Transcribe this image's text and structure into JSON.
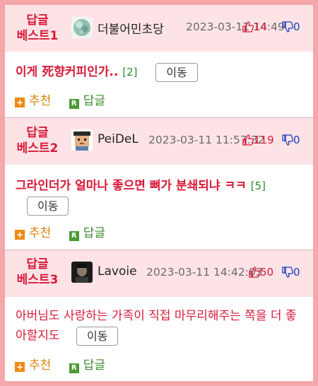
{
  "replies": [
    {
      "rank_top": "답글",
      "rank_bottom": "베스트1",
      "avatar": "green-crystal-icon",
      "nick": "더불어민초당",
      "date": "2023-03-11 14:49",
      "up": "14",
      "down": "0",
      "title": "이게 死향커피인가..",
      "count": "[2]",
      "move": "이동",
      "recommend": "추천",
      "reply": "답글"
    },
    {
      "rank_top": "답글",
      "rank_bottom": "베스트2",
      "avatar": "pixel-face-icon",
      "nick": "PeiDeL",
      "date": "2023-03-11 11:57:32",
      "up": "119",
      "down": "0",
      "title": "그라인더가 얼마나 좋으면 뼈가 분쇄되냐 ㅋㅋ",
      "count": "[5]",
      "move": "이동",
      "recommend": "추천",
      "reply": "답글"
    },
    {
      "rank_top": "답글",
      "rank_bottom": "베스트3",
      "avatar": "dark-portrait-icon",
      "nick": "Lavoie",
      "date": "2023-03-11 14:42:03",
      "up": "50",
      "down": "0",
      "title": "아버님도 사랑하는 가족이 직접 마무리해주는 쪽을 더 좋아할지도",
      "count": "",
      "move": "이동",
      "recommend": "추천",
      "reply": "답글"
    }
  ],
  "icons": {
    "recommend": "plus-icon",
    "reply": "r-badge-icon",
    "up": "thumbs-up-icon",
    "down": "thumbs-down-icon"
  },
  "colors": {
    "accent": "#d81b3a",
    "header_bg": "#fde3e6",
    "recommend": "#ef8a12",
    "reply": "#4d9a37",
    "down": "#1a3fbf"
  }
}
